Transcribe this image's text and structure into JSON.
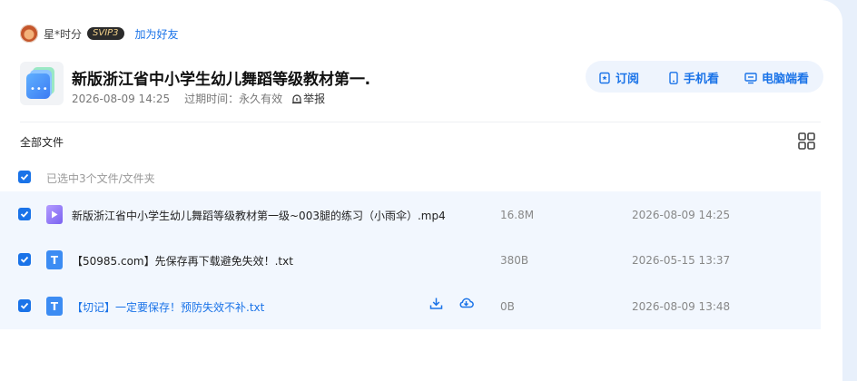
{
  "owner": {
    "name": "星*时分",
    "badge": "SVIP3",
    "add_friend": "加为好友"
  },
  "share": {
    "title": "新版浙江省中小学生幼儿舞蹈等级教材第一…",
    "date": "2026-08-09 14:25",
    "expire_label": "过期时间：",
    "expire_value": "永久有效",
    "report": "举报"
  },
  "actions": {
    "subscribe": "订阅",
    "mobile": "手机看",
    "desktop": "电脑端看"
  },
  "list": {
    "header": "全部文件",
    "selected_text": "已选中3个文件/文件夹"
  },
  "files": [
    {
      "icon": "video-icon",
      "name": "新版浙江省中小学生幼儿舞蹈等级教材第一级~003腿的练习（小雨伞）.mp4",
      "size": "16.8M",
      "date": "2026-08-09 14:25",
      "checked": true
    },
    {
      "icon": "text-file-icon",
      "icon_letter": "T",
      "name": "【50985.com】先保存再下载避免失效！.txt",
      "size": "380B",
      "date": "2026-05-15 13:37",
      "checked": true
    },
    {
      "icon": "text-file-icon",
      "icon_letter": "T",
      "name": "【切记】一定要保存！预防失效不补.txt",
      "size": "0B",
      "date": "2026-08-09 13:48",
      "checked": true
    }
  ],
  "colors": {
    "accent": "#1a73e8",
    "row_bg": "#f2f7fe",
    "pill_bg": "#eef4fd"
  }
}
